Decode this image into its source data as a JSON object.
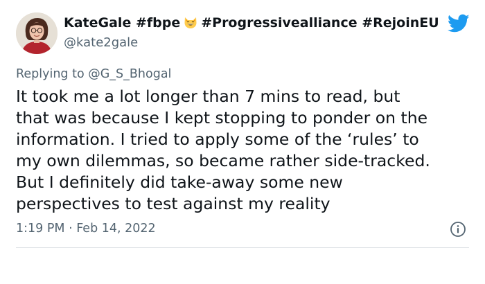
{
  "tweet": {
    "author": {
      "name_parts": [
        "KateGale #fbpe",
        "#Progressivealliance #RejoinEU"
      ],
      "handle": "@kate2gale",
      "emoji_icon": "grinning-cat-emoji",
      "verified": false
    },
    "brand_icon": "twitter-bird-icon",
    "brand_color": "#1d9bf0",
    "replying_to_label": "Replying to",
    "replying_to_handle": "@G_S_Bhogal",
    "link_color": "#1d9bf0",
    "body_lines": [
      "It took me a lot longer than 7 mins to read, but",
      "that was because I kept stopping to ponder on the",
      "information. I tried to apply some of the ‘rules’ to",
      "my own dilemmas, so became rather side-tracked.",
      "But I definitely did take-away some new",
      "perspectives to test against my reality"
    ],
    "timestamp": "1:19 PM · Feb 14, 2022",
    "info_icon": "info-icon"
  }
}
